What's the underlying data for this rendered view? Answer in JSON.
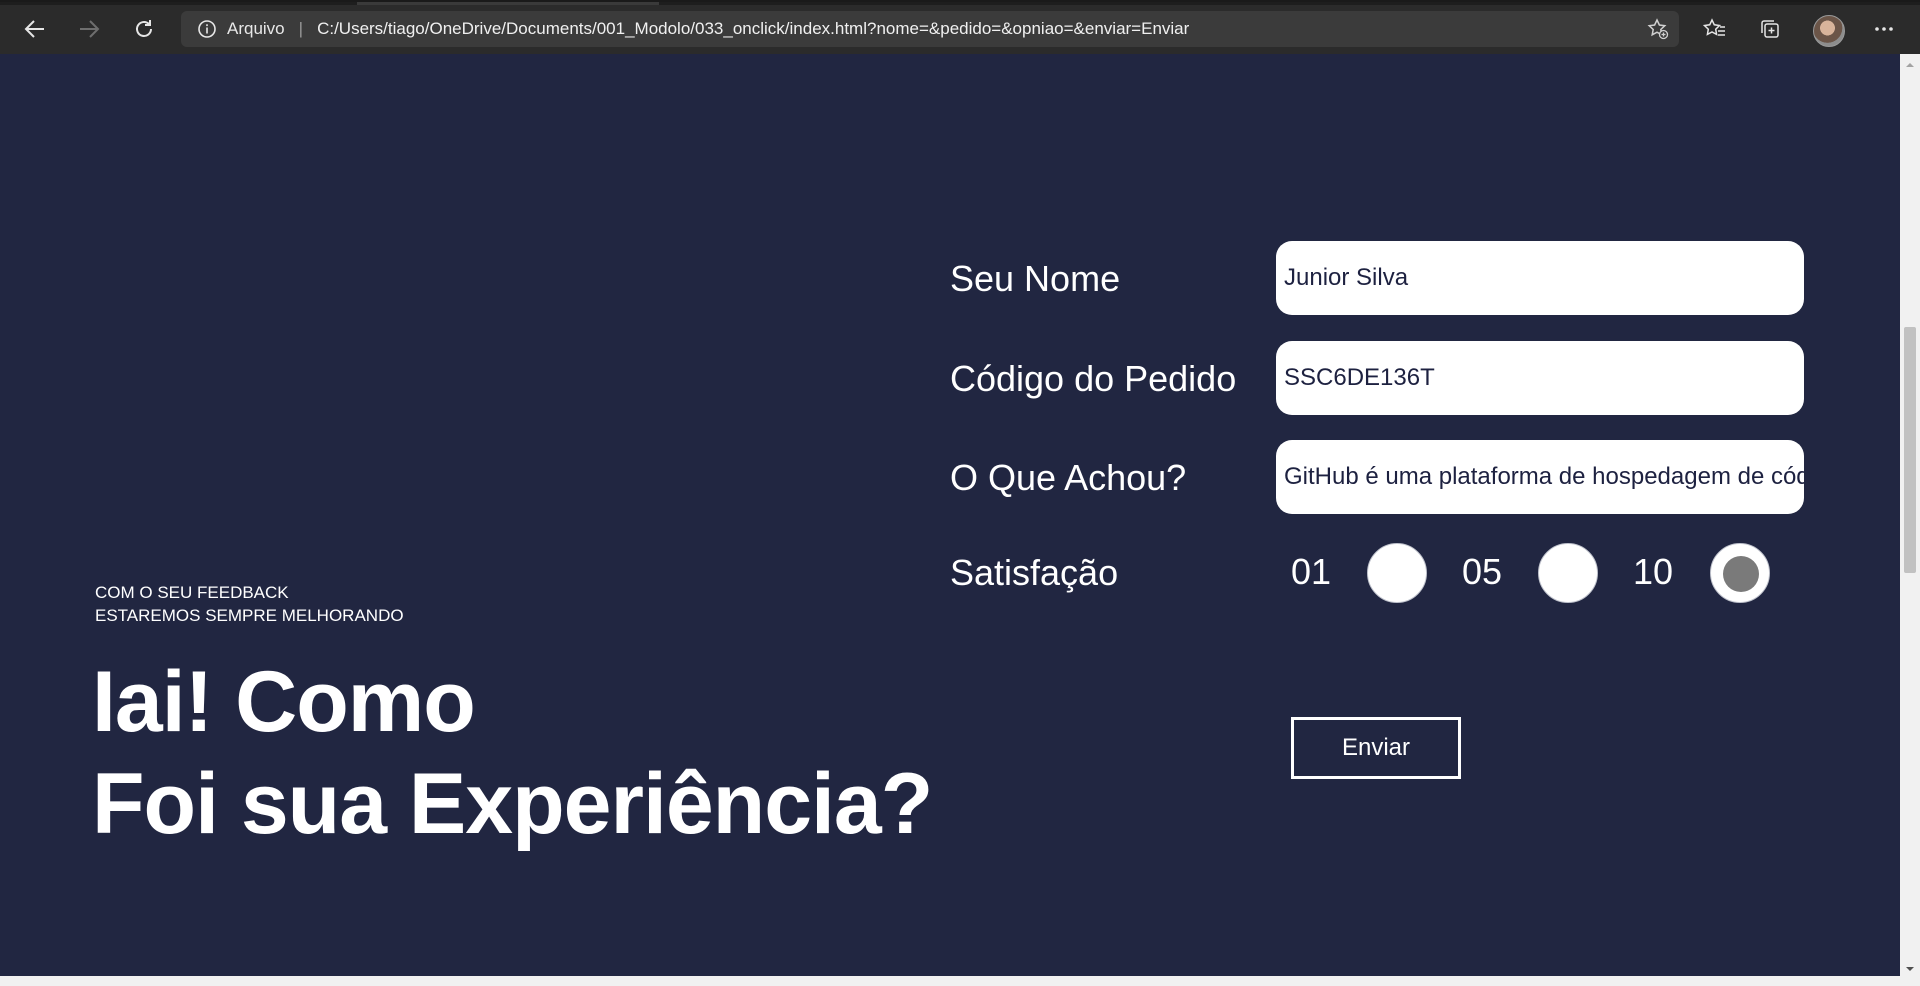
{
  "browser": {
    "site_label": "Arquivo",
    "url": "C:/Users/tiago/OneDrive/Documents/001_Modolo/033_onclick/index.html?nome=&pedido=&opniao=&enviar=Enviar"
  },
  "hero": {
    "subtitle_line1": "COM O SEU FEEDBACK",
    "subtitle_line2": "ESTAREMOS SEMPRE MELHORANDO",
    "title_line1": "Iai! Como",
    "title_line2": "Foi sua Experiência?"
  },
  "form": {
    "name_label": "Seu Nome",
    "name_value": "Junior Silva",
    "order_label": "Código do Pedido",
    "order_value": "SSC6DE136T",
    "opinion_label": "O Que Achou?",
    "opinion_value": "GitHub é uma plataforma de hospedagem de código",
    "satisfaction_label": "Satisfação",
    "ratings": [
      {
        "label": "01",
        "checked": false
      },
      {
        "label": "05",
        "checked": false
      },
      {
        "label": "10",
        "checked": true
      }
    ],
    "submit_label": "Enviar"
  }
}
